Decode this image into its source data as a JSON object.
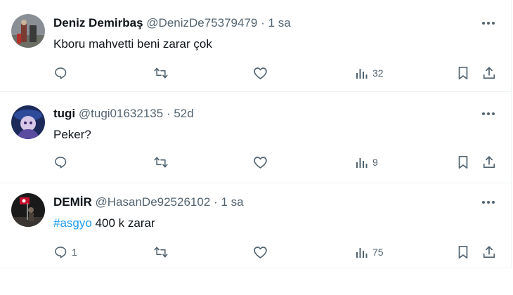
{
  "tweets": [
    {
      "author": "Deniz Demirbaş",
      "handle": "@DenizDe75379479",
      "dot": "·",
      "time": "1 sa",
      "text": "Kboru mahvetti beni zarar çok",
      "hashtag": "",
      "reply_count": "",
      "views": "32"
    },
    {
      "author": "tugi",
      "handle": "@tugi01632135",
      "dot": "·",
      "time": "52d",
      "text": "Peker?",
      "hashtag": "",
      "reply_count": "",
      "views": "9"
    },
    {
      "author": "DEMİR",
      "handle": "@HasanDe92526102",
      "dot": "·",
      "time": "1 sa",
      "text": " 400 k zarar",
      "hashtag": "#asgyo",
      "reply_count": "1",
      "views": "75"
    }
  ],
  "icons": {
    "reply": "reply-icon",
    "retweet": "retweet-icon",
    "like": "heart-icon",
    "views": "views-icon",
    "bookmark": "bookmark-icon",
    "share": "share-icon",
    "more": "more-icon"
  },
  "colors": {
    "text": "#0f1419",
    "secondary": "#536471",
    "link": "#1d9bf0",
    "divider": "#eff3f4"
  }
}
